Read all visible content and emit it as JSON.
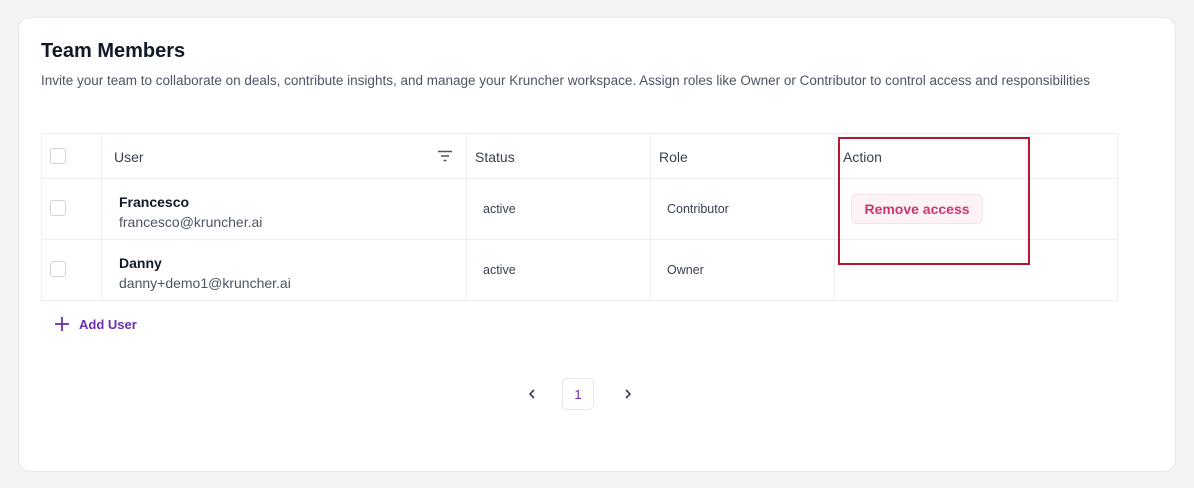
{
  "section": {
    "title": "Team Members",
    "description": "Invite your team to collaborate on deals, contribute insights, and manage your Kruncher workspace. Assign roles like Owner or Contributor to control access and responsibilities"
  },
  "table": {
    "columns": {
      "user": "User",
      "status": "Status",
      "role": "Role",
      "action": "Action"
    },
    "rows": [
      {
        "name": "Francesco",
        "email": "francesco@kruncher.ai",
        "status": "active",
        "role": "Contributor",
        "action_label": "Remove access"
      },
      {
        "name": "Danny",
        "email": "danny+demo1@kruncher.ai",
        "status": "active",
        "role": "Owner",
        "action_label": ""
      }
    ]
  },
  "add_user": {
    "label": "Add User"
  },
  "pagination": {
    "current_page": "1"
  },
  "icons": {
    "filter": "filter-icon",
    "plus": "plus-icon",
    "prev": "chevron-left-icon",
    "next": "chevron-right-icon"
  },
  "colors": {
    "accent": "#6b2fb3",
    "danger": "#c8386f",
    "highlight_border": "#b5172f"
  }
}
